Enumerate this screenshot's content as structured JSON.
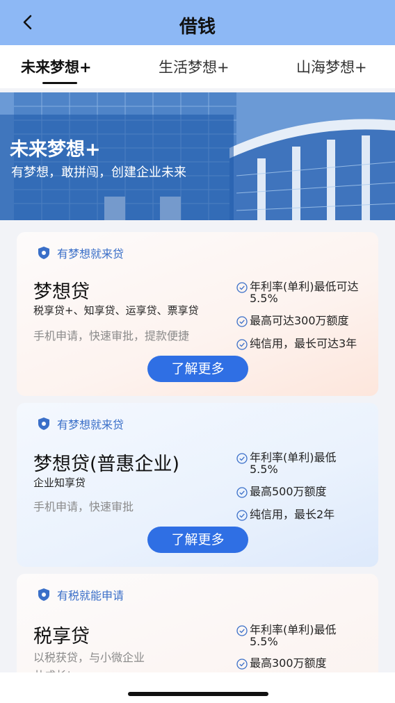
{
  "header": {
    "title": "借钱",
    "back_icon": "chevron-left-icon"
  },
  "tabs": [
    {
      "label": "未来梦想+",
      "active": true
    },
    {
      "label": "生活梦想+",
      "active": false
    },
    {
      "label": "山海梦想+",
      "active": false
    }
  ],
  "banner": {
    "title": "未来梦想+",
    "subtitle": "有梦想，敢拼闯，创建企业未来"
  },
  "cards": [
    {
      "badge": "有梦想就来贷",
      "title": "梦想贷",
      "subtitle": "税享贷+、知享贷、运享贷、票享贷",
      "description": "手机申请，快速审批，提款便捷",
      "features": [
        "年利率(单利)最低可达\n5.5%",
        "最高可达300万额度",
        "纯信用，最长可达3年"
      ],
      "button": "了解更多"
    },
    {
      "badge": "有梦想就来贷",
      "title": "梦想贷(普惠企业)",
      "subtitle": "企业知享贷",
      "description": "手机申请，快速审批",
      "features": [
        "年利率(单利)最低\n5.5%",
        "最高500万额度",
        "纯信用，最长2年"
      ],
      "button": "了解更多"
    },
    {
      "badge": "有税就能申请",
      "title": "税享贷",
      "description": "以税获贷，与小微企业\n共成长!",
      "features": [
        "年利率(单利)最低\n5.5%",
        "最高300万额度"
      ]
    }
  ],
  "colors": {
    "header_bg": "#8db8f5",
    "accent": "#2f6fe4",
    "badge_text": "#3a6fc8"
  }
}
